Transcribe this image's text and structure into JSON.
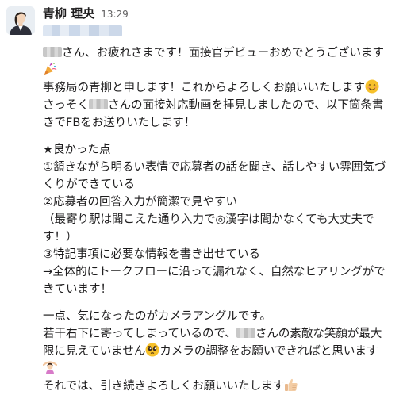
{
  "message": {
    "sender": "青柳 理央",
    "timestamp": "13:29",
    "lines": {
      "l1": "さん、お疲れさまです！面接官デビューおめでとうございます",
      "l2": "事務局の青柳と申します！これからよろしくお願いいたします",
      "l3a": "さっそく",
      "l3b": "さんの面接対応動画を拝見しましたので、以下箇条書",
      "l4": "きでFBをお送りいたします！",
      "l5": "★良かった点",
      "l6": "①頷きながら明るい表情で応募者の話を聞き、話しやすい雰囲気づ",
      "l7": "くりができている",
      "l8": "②応募者の回答入力が簡潔で見やすい",
      "l9": "（最寄り駅は聞こえた通り入力で◎漢字は聞かなくても大丈夫で",
      "l10": "す！）",
      "l11": "③特記事項に必要な情報を書き出せている",
      "l12": "→全体的にトークフローに沿って漏れなく、自然なヒアリングがで",
      "l13": "きています！",
      "l14": "一点、気になったのがカメラアングルです。",
      "l15a": "若干右下に寄ってしまっているので、",
      "l15b": "さんの素敵な笑顔が最大",
      "l16a": "限に見えていません",
      "l16b": "カメラの調整をお願いできればと思います",
      "l18": "それでは、引き続きよろしくお願いいたします"
    }
  },
  "emojis": [
    "party-popper",
    "smiling-face",
    "pleading-face",
    "woman-gesturing-ok",
    "thumbs-up"
  ],
  "colors": {
    "text": "#1d1c1d",
    "timestamp": "#616061",
    "emoji_yellow": "#f7c12b"
  }
}
